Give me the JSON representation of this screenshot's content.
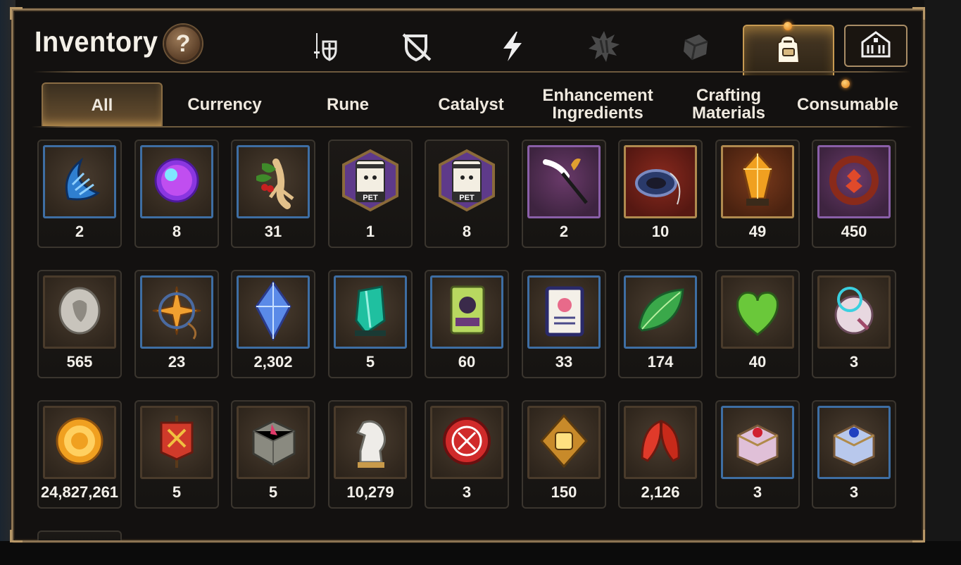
{
  "title": "Inventory",
  "help_label": "?",
  "category_tabs": [
    {
      "icon": "sword-shield-icon"
    },
    {
      "icon": "shield-cross-icon"
    },
    {
      "icon": "lightning-icon"
    },
    {
      "icon": "rune-burst-icon"
    },
    {
      "icon": "cube-icon"
    },
    {
      "icon": "backpack-icon",
      "active": true
    },
    {
      "icon": "guild-hall-icon"
    }
  ],
  "sub_tabs": [
    {
      "label": "All",
      "active": true
    },
    {
      "label": "Currency"
    },
    {
      "label": "Rune"
    },
    {
      "label": "Catalyst"
    },
    {
      "label": "Enhancement Ingredients"
    },
    {
      "label": "Crafting Materials"
    },
    {
      "label": "Consumable"
    }
  ],
  "items": [
    {
      "count": "2",
      "icon": "blue-claw-icon",
      "frame": "blue"
    },
    {
      "count": "8",
      "icon": "purple-orb-icon",
      "frame": "blue"
    },
    {
      "count": "31",
      "icon": "ginseng-root-icon",
      "frame": "blue"
    },
    {
      "count": "1",
      "icon": "pet-food-bag-icon",
      "frame": "hex"
    },
    {
      "count": "8",
      "icon": "pet-food-bag-icon",
      "frame": "hex"
    },
    {
      "count": "2",
      "icon": "feather-wand-icon",
      "frame": "purple"
    },
    {
      "count": "10",
      "icon": "pendant-ring-icon",
      "frame": "gold"
    },
    {
      "count": "49",
      "icon": "amber-crystal-icon",
      "frame": "gold2"
    },
    {
      "count": "450",
      "icon": "red-charm-icon",
      "frame": "purple"
    },
    {
      "count": "565",
      "icon": "silver-coin-icon",
      "frame": "brown"
    },
    {
      "count": "23",
      "icon": "star-amulet-icon",
      "frame": "blue"
    },
    {
      "count": "2,302",
      "icon": "blue-crystal-icon",
      "frame": "blue"
    },
    {
      "count": "5",
      "icon": "green-crystal-icon",
      "frame": "blue"
    },
    {
      "count": "60",
      "icon": "green-card-icon",
      "frame": "blue"
    },
    {
      "count": "33",
      "icon": "purple-card-icon",
      "frame": "blue"
    },
    {
      "count": "174",
      "icon": "green-leaf-icon",
      "frame": "blue"
    },
    {
      "count": "40",
      "icon": "green-heart-icon",
      "frame": "brown"
    },
    {
      "count": "3",
      "icon": "robot-orb-icon",
      "frame": "brown"
    },
    {
      "count": "24,827,261",
      "icon": "gold-coin-icon",
      "frame": "brown"
    },
    {
      "count": "5",
      "icon": "red-banner-icon",
      "frame": "brown"
    },
    {
      "count": "5",
      "icon": "stone-cube-icon",
      "frame": "brown"
    },
    {
      "count": "10,279",
      "icon": "chess-knight-icon",
      "frame": "brown"
    },
    {
      "count": "3",
      "icon": "red-seal-icon",
      "frame": "brown"
    },
    {
      "count": "150",
      "icon": "fist-emblem-icon",
      "frame": "brown"
    },
    {
      "count": "2,126",
      "icon": "red-leaves-icon",
      "frame": "brown"
    },
    {
      "count": "3",
      "icon": "pink-chest-icon",
      "frame": "blue"
    },
    {
      "count": "3",
      "icon": "blue-chest-icon",
      "frame": "blue"
    }
  ]
}
